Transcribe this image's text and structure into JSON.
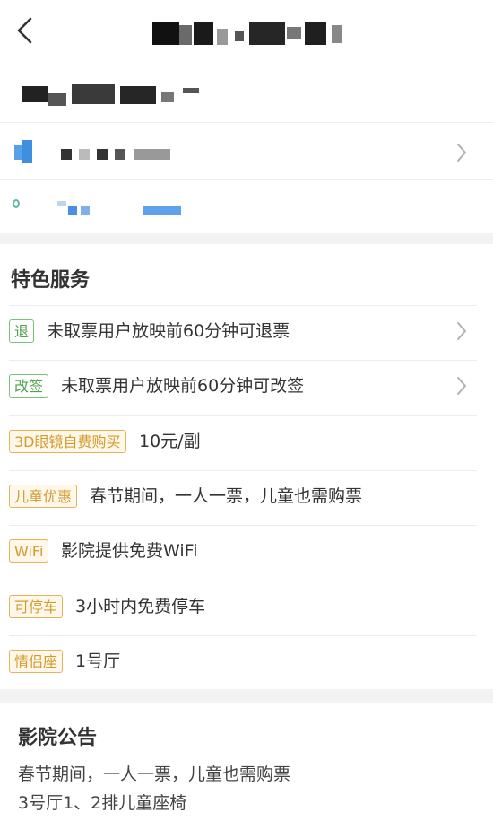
{
  "header": {
    "back_icon": "chevron-left-icon"
  },
  "info": {
    "row_chevron_icon": "chevron-right-icon",
    "location_icon": "location-pin-icon"
  },
  "services": {
    "title": "特色服务",
    "items": [
      {
        "tag": "退",
        "style": "green",
        "text": "未取票用户放映前60分钟可退票",
        "has_chevron": true
      },
      {
        "tag": "改签",
        "style": "green",
        "text": "未取票用户放映前60分钟可改签",
        "has_chevron": true
      },
      {
        "tag": "3D眼镜自费购买",
        "style": "orange",
        "text": "10元/副",
        "has_chevron": false
      },
      {
        "tag": "儿童优惠",
        "style": "orange",
        "text": "春节期间，一人一票，儿童也需购票",
        "has_chevron": false
      },
      {
        "tag": "WiFi",
        "style": "orange",
        "text": "影院提供免费WiFi",
        "has_chevron": false
      },
      {
        "tag": "可停车",
        "style": "orange",
        "text": "3小时内免费停车",
        "has_chevron": false
      },
      {
        "tag": "情侣座",
        "style": "orange",
        "text": "1号厅",
        "has_chevron": false
      }
    ]
  },
  "notice": {
    "title": "影院公告",
    "lines": [
      "春节期间，一人一票，儿童也需购票",
      "3号厅1、2排儿童座椅"
    ]
  },
  "colors": {
    "green_tag": "#4fa24d",
    "orange_tag": "#d39a2c",
    "background": "#f2f2f2"
  }
}
